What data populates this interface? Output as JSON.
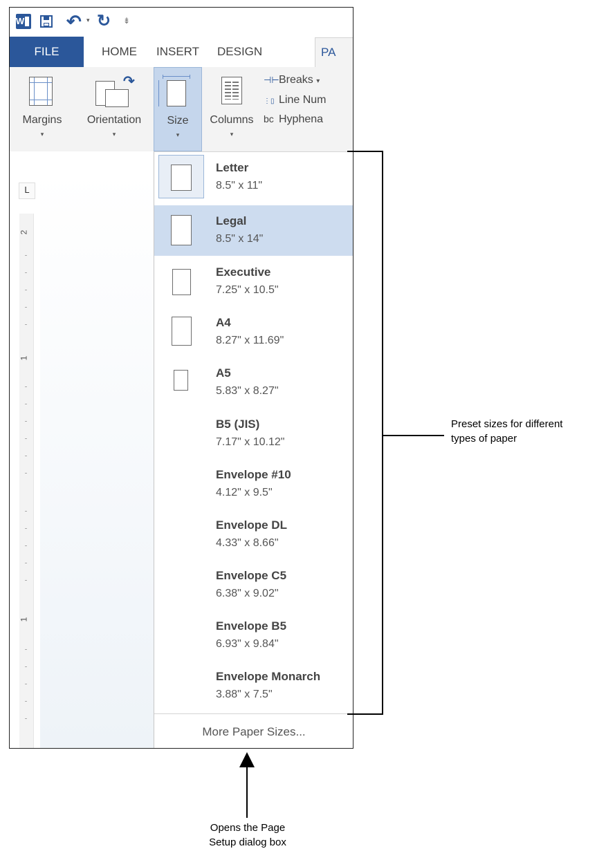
{
  "quick_access": {
    "word_icon": "W",
    "undo_glyph": "↶",
    "dropdown_glyph": "▾",
    "redo_glyph": "↻",
    "customize_glyph": "⇟"
  },
  "tabs": {
    "file": "FILE",
    "home": "HOME",
    "insert": "INSERT",
    "design": "DESIGN",
    "page_layout_partial": "PA"
  },
  "ribbon": {
    "margins": "Margins",
    "orientation": "Orientation",
    "size": "Size",
    "columns": "Columns",
    "breaks": "Breaks",
    "breaks_arrow": "▾",
    "line_numbers_partial": "Line Num",
    "hyphenation_partial": "Hyphena",
    "hyphen_icon": "bc",
    "arrow": "▾"
  },
  "ruler": {
    "tab_stop": "L",
    "numbers": [
      "2",
      "1",
      "1"
    ]
  },
  "size_menu": {
    "items": [
      {
        "name": "Letter",
        "dims": "8.5\" x 11\""
      },
      {
        "name": "Legal",
        "dims": "8.5\" x 14\""
      },
      {
        "name": "Executive",
        "dims": "7.25\" x 10.5\""
      },
      {
        "name": "A4",
        "dims": "8.27\" x 11.69\""
      },
      {
        "name": "A5",
        "dims": "5.83\" x 8.27\""
      },
      {
        "name": "B5 (JIS)",
        "dims": "7.17\" x 10.12\""
      },
      {
        "name": "Envelope #10",
        "dims": "4.12\" x 9.5\""
      },
      {
        "name": "Envelope DL",
        "dims": "4.33\" x 8.66\""
      },
      {
        "name": "Envelope C5",
        "dims": "6.38\" x 9.02\""
      },
      {
        "name": "Envelope B5",
        "dims": "6.93\" x 9.84\""
      },
      {
        "name": "Envelope Monarch",
        "dims": "3.88\" x 7.5\""
      }
    ],
    "more": "More Paper Sizes..."
  },
  "callouts": {
    "right_line1": "Preset sizes for different",
    "right_line2": "types of paper",
    "bottom_line1": "Opens the Page",
    "bottom_line2": "Setup dialog box"
  },
  "colors": {
    "accent": "#2b579a",
    "selected_item": "#cddcef",
    "ribbon_bg": "#f3f3f3"
  }
}
